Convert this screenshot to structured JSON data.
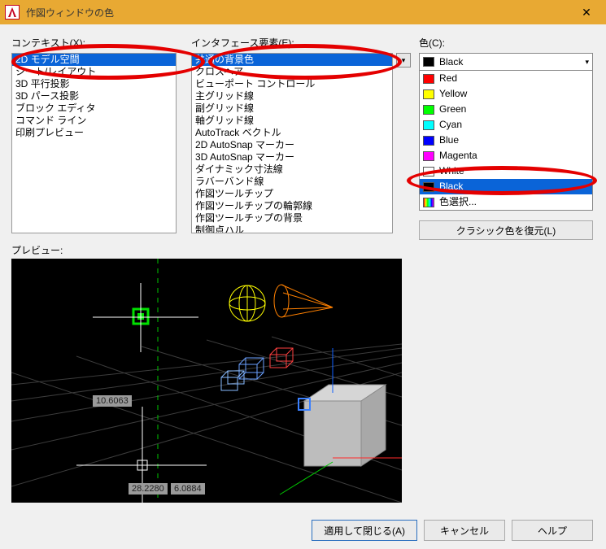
{
  "titlebar": {
    "title": "作図ウィンドウの色"
  },
  "labels": {
    "context": "コンテキスト(X):",
    "interface": "インタフェース要素(E):",
    "color": "色(C):",
    "preview": "プレビュー:"
  },
  "context_items": [
    "2D モデル空間",
    "シート/レイアウト",
    "3D 平行投影",
    "3D パース投影",
    "ブロック エディタ",
    "コマンド ライン",
    "印刷プレビュー"
  ],
  "context_selected_index": 0,
  "interface_items": [
    "共通の背景色",
    "クロスヘア",
    "ビューポート コントロール",
    "主グリッド線",
    "副グリッド線",
    "軸グリッド線",
    "AutoTrack ベクトル",
    "2D AutoSnap マーカー",
    "3D AutoSnap マーカー",
    "ダイナミック寸法線",
    "ラバーバンド線",
    "作図ツールチップ",
    "作図ツールチップの輪郭線",
    "作図ツールチップの背景",
    "制御点ハル"
  ],
  "interface_selected_index": 0,
  "color_combo": {
    "selected": "Black",
    "swatch": "#000000"
  },
  "color_options": [
    {
      "label": "Red",
      "swatch": "#ff0000"
    },
    {
      "label": "Yellow",
      "swatch": "#ffff00"
    },
    {
      "label": "Green",
      "swatch": "#00ff00"
    },
    {
      "label": "Cyan",
      "swatch": "#00ffff"
    },
    {
      "label": "Blue",
      "swatch": "#0000ff"
    },
    {
      "label": "Magenta",
      "swatch": "#ff00ff"
    },
    {
      "label": "White",
      "swatch": "#ffffff"
    },
    {
      "label": "Black",
      "swatch": "#000000",
      "selected": true
    },
    {
      "label": "色選択...",
      "swatch": "rainbow"
    }
  ],
  "buttons": {
    "restore": "クラシック色を復元(L)",
    "apply_close": "適用して閉じる(A)",
    "cancel": "キャンセル",
    "help": "ヘルプ"
  },
  "preview_coords": {
    "c1": "10.6063",
    "c2a": "28.2280",
    "c2b": "6.0884"
  }
}
